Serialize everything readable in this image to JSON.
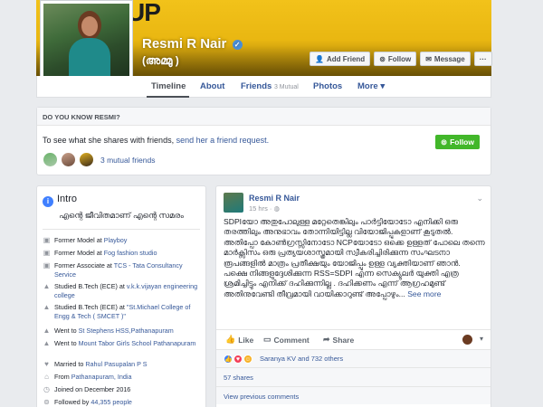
{
  "cover": {
    "text": "UP"
  },
  "profile": {
    "name": "Resmi R Nair",
    "verified_icon": "verified-badge-icon",
    "nickname": "(അമ്മു )"
  },
  "cover_buttons": {
    "add_friend": "Add Friend",
    "follow": "Follow",
    "message": "Message",
    "more": "···"
  },
  "nav": {
    "timeline": "Timeline",
    "about": "About",
    "friends": "Friends",
    "friends_mutual": "3 Mutual",
    "photos": "Photos",
    "more": "More"
  },
  "know_box": {
    "heading": "DO YOU KNOW RESMI?",
    "text": "To see what she shares with friends,",
    "link": "send her a friend request.",
    "follow": "Follow",
    "mutual": "3 mutual friends"
  },
  "intro": {
    "title": "Intro",
    "bio": "എന്റെ ജീവിതമാണ് എന്റെ സമരം",
    "items": [
      {
        "prefix": "Former Model at ",
        "link": "Playboy",
        "icon": "briefcase-icon"
      },
      {
        "prefix": "Former Model at ",
        "link": "Fog fashion studio",
        "icon": "briefcase-icon"
      },
      {
        "prefix": "Former Associate at ",
        "link": "TCS - Tata Consultancy Service",
        "icon": "briefcase-icon"
      },
      {
        "prefix": "Studied B.Tech (ECE) at ",
        "link": "v.k.k.vijayan engineering college",
        "icon": "graduation-cap-icon"
      },
      {
        "prefix": "Studied B.Tech (ECE) at ",
        "link": "\"St.Michael College of Engg & Tech ( SMCET )\"",
        "icon": "graduation-cap-icon"
      },
      {
        "prefix": "Went to ",
        "link": "St Stephens HSS,Pathanapuram",
        "icon": "graduation-cap-icon"
      },
      {
        "prefix": "Went to ",
        "link": "Mount Tabor Girls School Pathanapuram",
        "icon": "graduation-cap-icon"
      },
      {
        "prefix": "Married to ",
        "link": "Rahul Pasupalan P S",
        "icon": "heart-icon"
      },
      {
        "prefix": "From ",
        "link": "Pathanapuram, India",
        "icon": "location-pin-icon"
      },
      {
        "prefix": "Joined on December 2016",
        "link": "",
        "icon": "clock-icon"
      },
      {
        "prefix": "Followed by ",
        "link": "44,355 people",
        "icon": "rss-icon"
      }
    ]
  },
  "post": {
    "author": "Resmi R Nair",
    "time": "15 hrs · ",
    "body": "SDPIയോ അതുപോലുള്ള മറ്റേതെങ്കിലും പാർട്ടിയോടോ എനിക്കി ഒരു തരത്തിലും അനുഭാവം തോന്നിയിട്ടില്ല വിയോജിപ്പുകളാണ് കൂടുതൽ. അതിപ്പോ കോൺഗ്രസ്സിനോടോ NCPയോടോ ഒക്കെ ഉള്ളത് പോലെ തന്നെ മാർക്സിസം ഒരു പ്രത്യയശാസ്ത്രമായി സ്വീകരിച്ചിരിക്കുന്ന സംഘടനാ രൂപങ്ങളിൽ മാത്രം പ്രതീക്ഷയും യോജിപ്പും ഉള്ള വ്യക്തിയാണ് ഞാൻ. പക്ഷെ നിങ്ങളുദ്ദേശിക്കുന്ന RSS=SDPI എന്ന സെക്യുലർ യുക്തി എത്ര ശ്രമിച്ചിട്ടും എനിക്ക് ദഹിക്കുന്നില്ല . ദഹിക്കണം എന്ന് ആഗ്രഹമുണ്ട് അതിനുവേണ്ടി തീവ്രമായി വായിക്കാറുണ്ട് അപ്പോഴും...",
    "see_more": "See more",
    "like": "Like",
    "comment": "Comment",
    "share": "Share",
    "reactions": "Saranya KV and 732 others",
    "shares": "57 shares",
    "view_previous": "View previous comments"
  }
}
